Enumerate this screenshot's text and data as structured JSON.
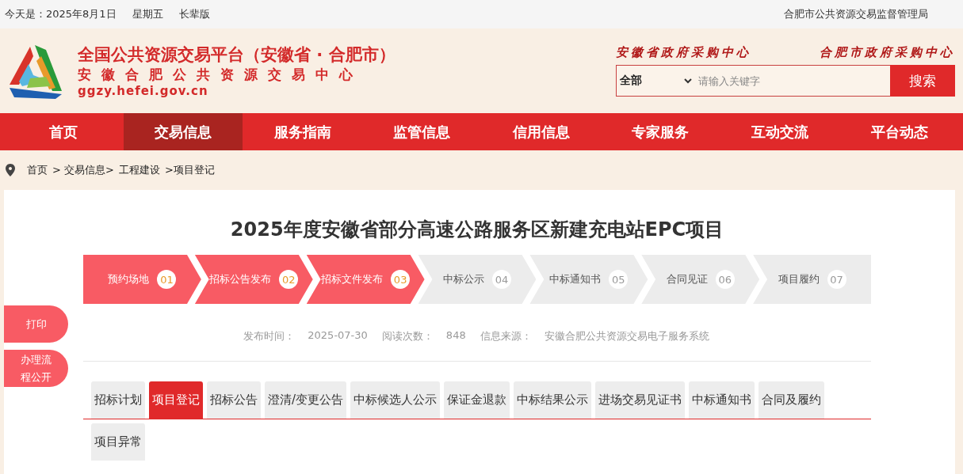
{
  "top_bar": {
    "date": "今天是：2025年8月1日",
    "weekday": "星期五",
    "elder_mode": "长辈版",
    "agency": "合肥市公共资源交易监督管理局"
  },
  "header": {
    "title": "全国公共资源交易平台（安徽省 · 合肥市）",
    "subtitle": "安徽合肥公共资源交易中心",
    "url": "ggzy.hefei.gov.cn",
    "links": [
      "安徽省政府采购中心",
      "合肥市政府采购中心"
    ],
    "search": {
      "scope": "全部",
      "placeholder": "请输入关键字",
      "button": "搜索"
    }
  },
  "nav": [
    {
      "label": "首页",
      "selected": false
    },
    {
      "label": "交易信息",
      "selected": true
    },
    {
      "label": "服务指南",
      "selected": false
    },
    {
      "label": "监管信息",
      "selected": false
    },
    {
      "label": "信用信息",
      "selected": false
    },
    {
      "label": "专家服务",
      "selected": false
    },
    {
      "label": "互动交流",
      "selected": false
    },
    {
      "label": "平台动态",
      "selected": false
    }
  ],
  "breadcrumb": [
    "首页",
    "> 交易信息>",
    "工程建设",
    ">项目登记"
  ],
  "side_buttons": [
    "打印",
    "办理流程公开"
  ],
  "article": {
    "title": "2025年度安徽省部分高速公路服务区新建充电站EPC项目",
    "steps": [
      {
        "label": "预约场地",
        "number": "01",
        "done": true
      },
      {
        "label": "招标公告发布",
        "number": "02",
        "done": true
      },
      {
        "label": "招标文件发布",
        "number": "03",
        "done": true
      },
      {
        "label": "中标公示",
        "number": "04",
        "done": false
      },
      {
        "label": "中标通知书",
        "number": "05",
        "done": false
      },
      {
        "label": "合同见证",
        "number": "06",
        "done": false
      },
      {
        "label": "项目履约",
        "number": "07",
        "done": false
      }
    ],
    "meta": [
      {
        "label": "发布时间：",
        "value": "2025-07-30"
      },
      {
        "label": "阅读次数：",
        "value": "848"
      },
      {
        "label": "信息来源：",
        "value": "安徽合肥公共资源交易电子服务系统"
      }
    ],
    "tabs": [
      {
        "label": "招标计划",
        "selected": false
      },
      {
        "label": "项目登记",
        "selected": true
      },
      {
        "label": "招标公告",
        "selected": false
      },
      {
        "label": "澄清/变更公告",
        "selected": false
      },
      {
        "label": "中标候选人公示",
        "selected": false
      },
      {
        "label": "保证金退款",
        "selected": false
      },
      {
        "label": "中标结果公示",
        "selected": false
      },
      {
        "label": "进场交易见证书",
        "selected": false
      },
      {
        "label": "中标通知书",
        "selected": false
      },
      {
        "label": "合同及履约",
        "selected": false
      },
      {
        "label": "项目异常",
        "selected": false
      }
    ]
  }
}
